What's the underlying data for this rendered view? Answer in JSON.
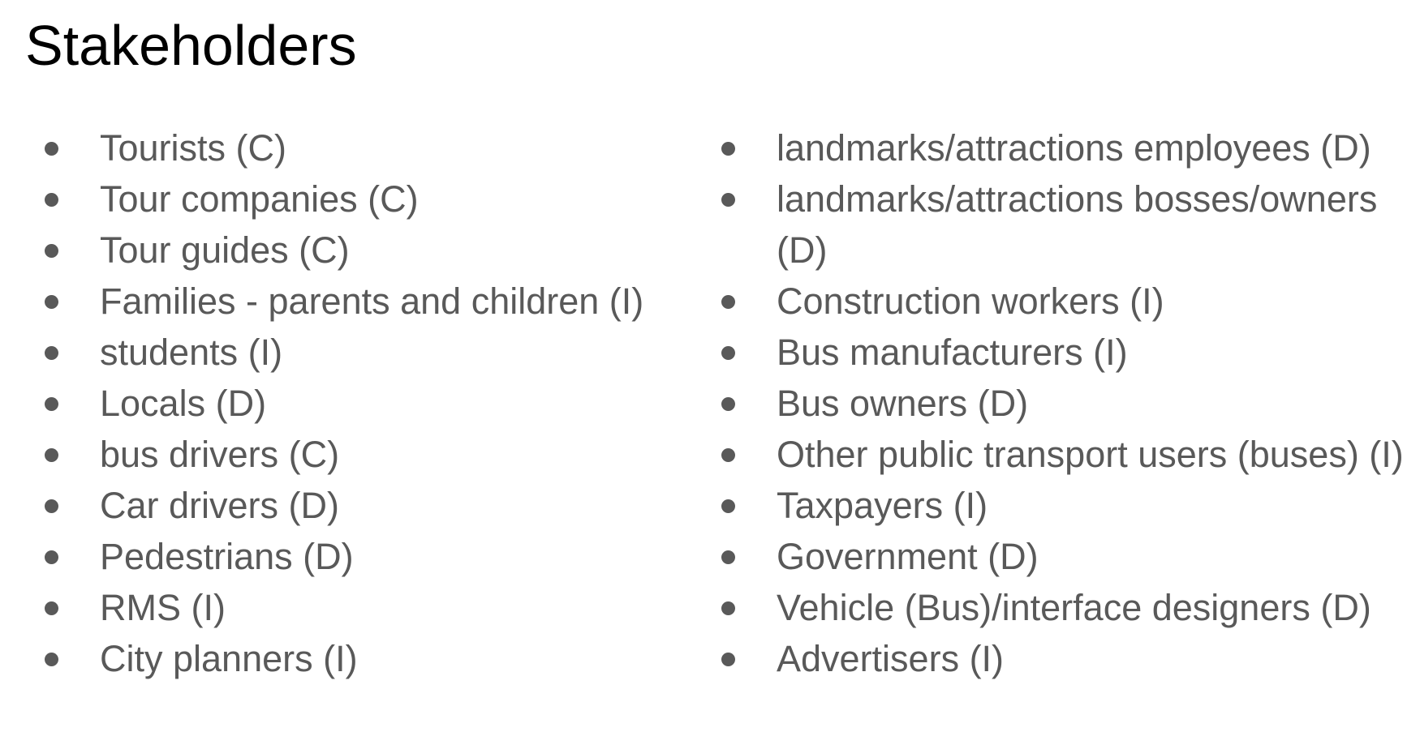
{
  "slide": {
    "title": "Stakeholders",
    "left_column": [
      "Tourists (C)",
      "Tour companies (C)",
      "Tour guides (C)",
      "Families - parents and children (I)",
      "students (I)",
      "Locals (D)",
      "bus drivers (C)",
      "Car drivers (D)",
      "Pedestrians (D)",
      "RMS (I)",
      "City planners (I)"
    ],
    "right_column": [
      "landmarks/attractions employees (D)",
      "landmarks/attractions bosses/owners (D)",
      "Construction workers (I)",
      "Bus manufacturers (I)",
      "Bus owners (D)",
      "Other public transport users (buses) (I)",
      "Taxpayers (I)",
      "Government (D)",
      "Vehicle (Bus)/interface designers (D)",
      "Advertisers (I)"
    ]
  }
}
